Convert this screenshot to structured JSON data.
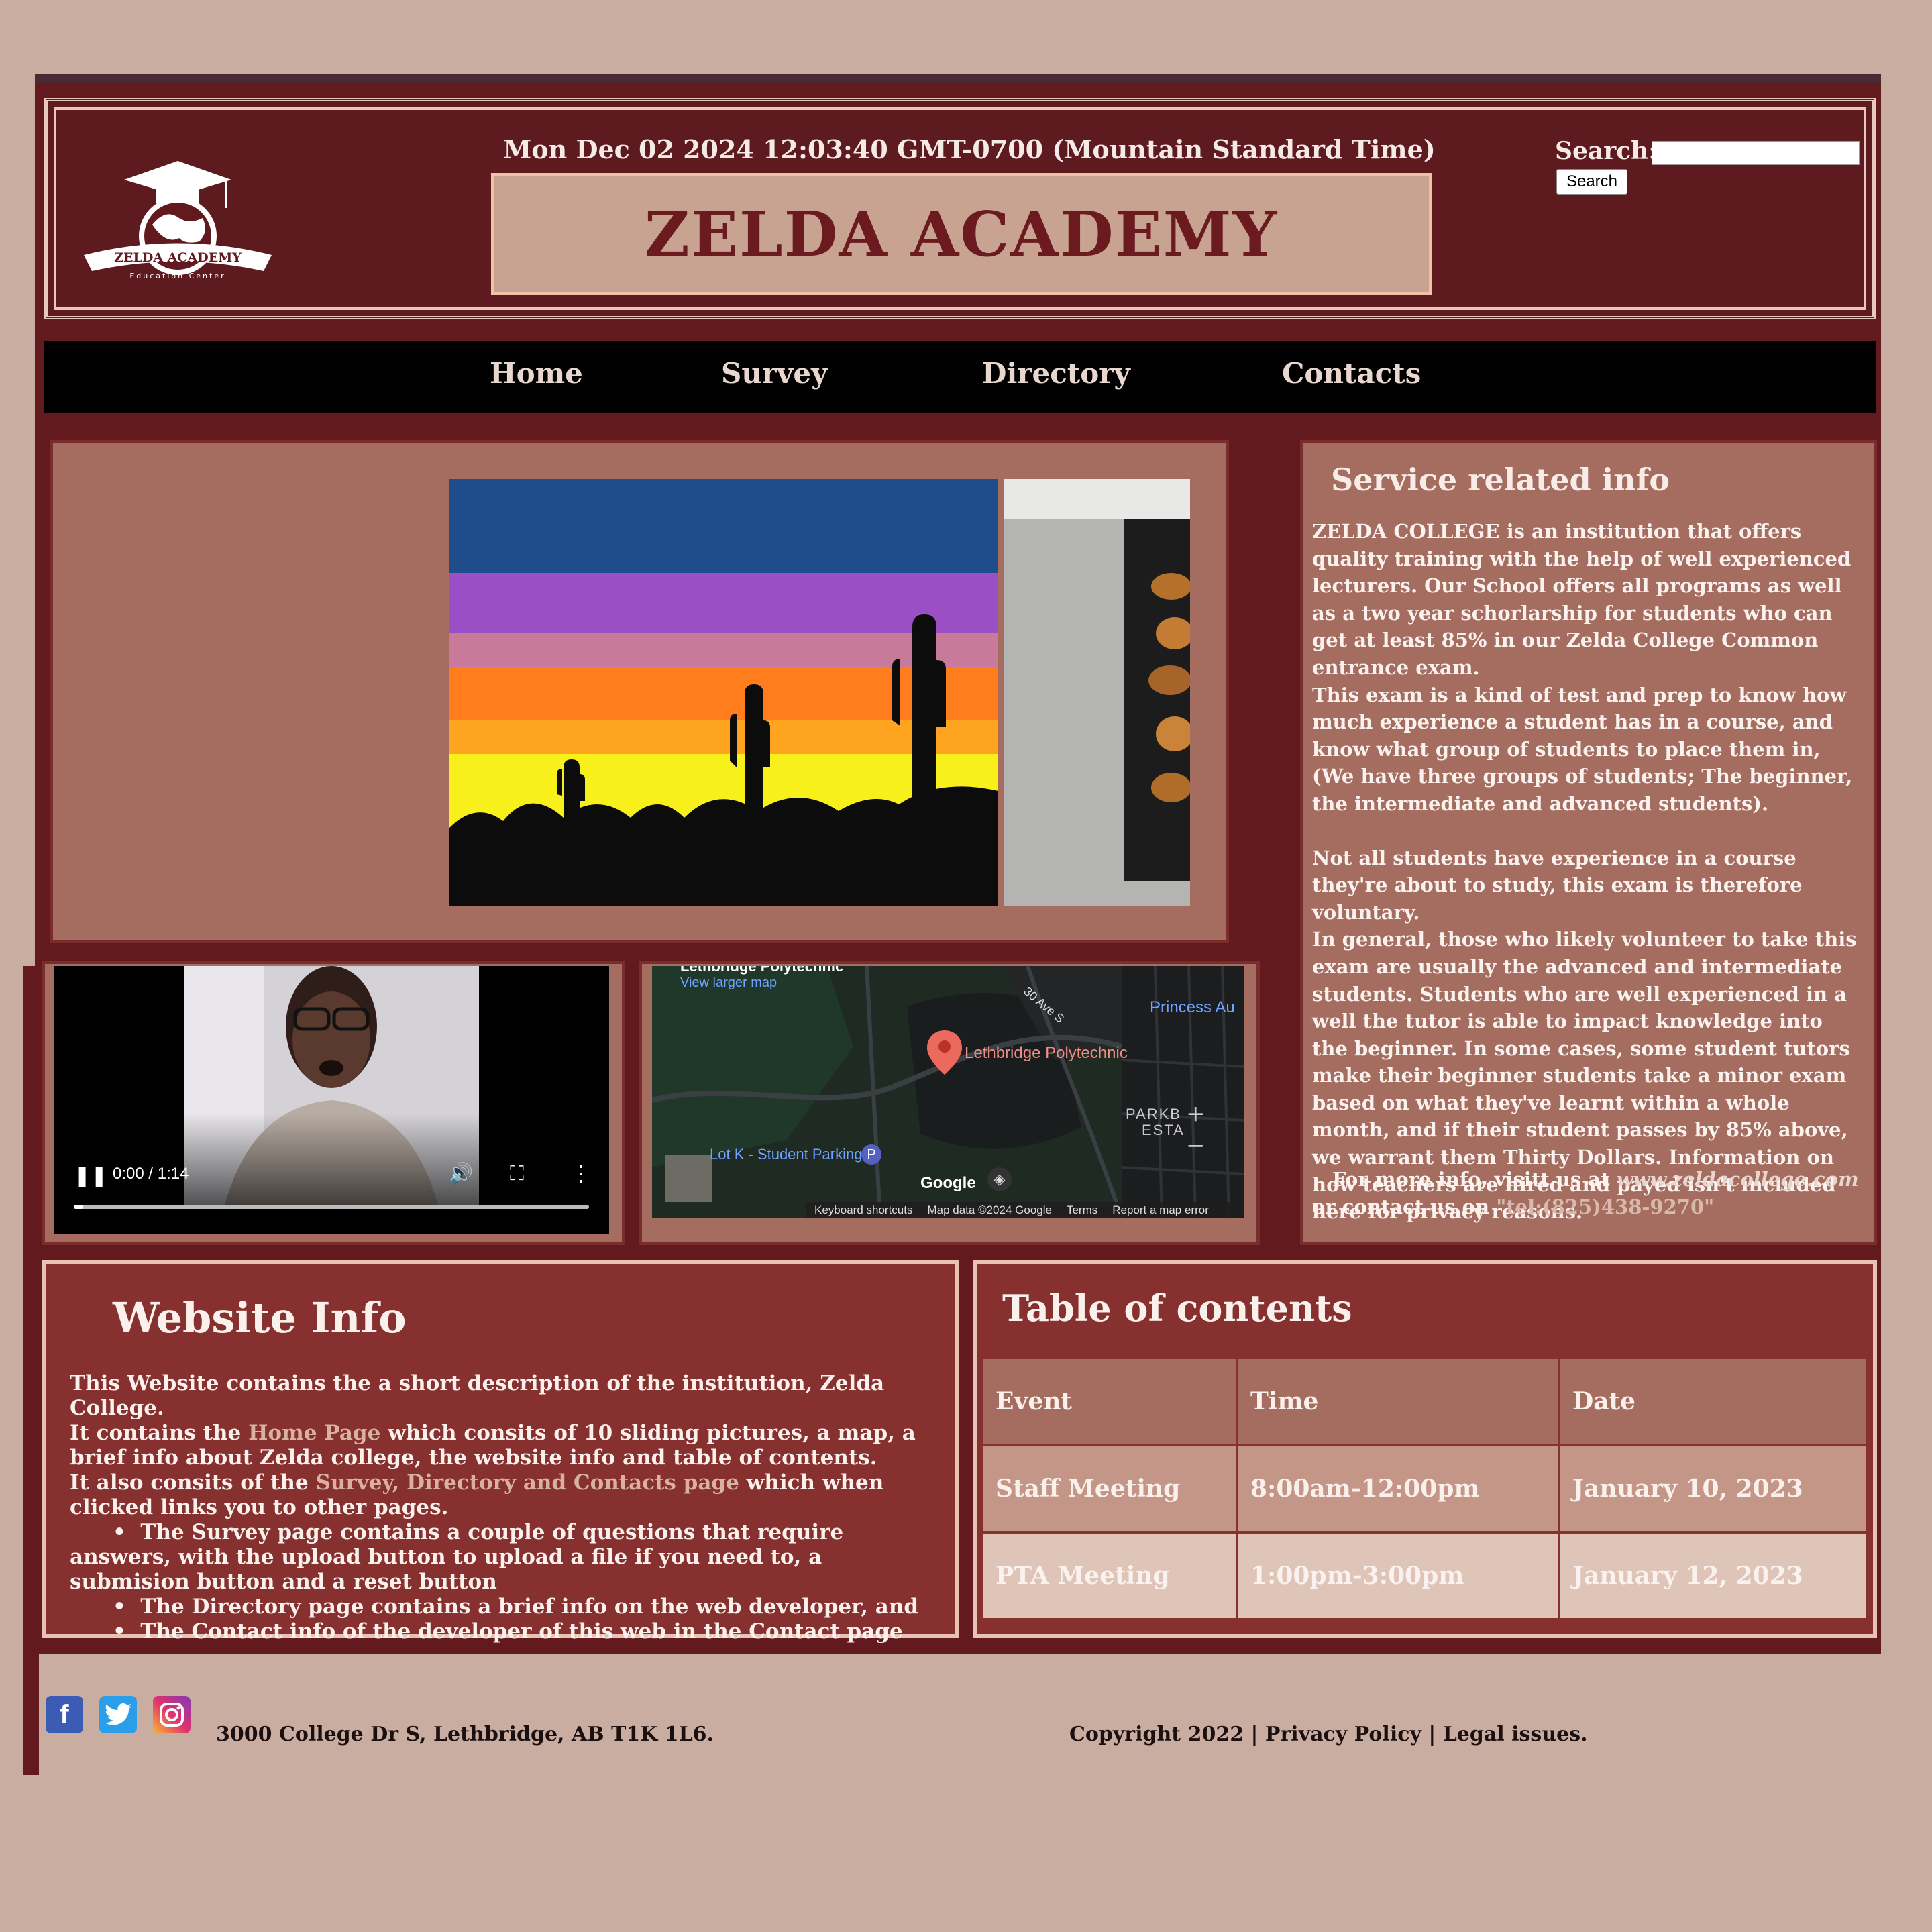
{
  "header": {
    "datetime": "Mon Dec 02 2024 12:03:40 GMT-0700 (Mountain Standard Time)",
    "title": "ZELDA ACADEMY",
    "logo_text": "ZELDA ACADEMY",
    "logo_subtext": "Education Center",
    "search_label": "Search:",
    "search_value": "",
    "search_button": "Search"
  },
  "nav": {
    "items": [
      "Home",
      "Survey",
      "Directory",
      "Contacts"
    ]
  },
  "service": {
    "title": "Service related info",
    "p1": "ZELDA COLLEGE is an institution that offers quality training with the help of well experienced lecturers. Our School offers all programs as well as a two year schorlarship for students who can get at least 85% in our Zelda College Common entrance exam.",
    "p2": "This exam is a kind of test and prep to know how much experience a student has in a course, and know what group of students to place them in, (We have three groups of students; The beginner, the intermediate and advanced students).",
    "p3": "Not all students have experience in a course they're about to study, this exam is therefore voluntary.",
    "p4": "In general, those who likely volunteer to take this exam are usually the advanced and intermediate students. Students who are well experienced in a well the tutor is able to impact knowledge into the beginner. In some cases, some student tutors make their beginner students take a minor exam based on what they've learnt within a whole month, and if their student passes by 85% above, we warrant them Thirty Dollars. Information on how teachers are hired and payed isn't included here for privacy reasons.",
    "more_prefix": "For more info, visitt us at",
    "more_link": "www.zeldacollege.com",
    "more_mid": "or contact us on",
    "more_tel": "\"tel:(825)438-9270\""
  },
  "video": {
    "time": "0:00 / 1:14",
    "progress": 0.0
  },
  "map": {
    "place_header": "Lethbridge Polytechnic",
    "view_larger": "View larger map",
    "marker_label": "Lethbridge Polytechnic",
    "road_label": "30 Ave S",
    "area_label": "Princess Au",
    "parking_label": "Lot K - Student Parking",
    "parkb_label": "PARKB",
    "esta_label": "ESTA",
    "logo": "Google",
    "footer_shortcuts": "Keyboard shortcuts",
    "footer_data": "Map data ©2024 Google",
    "footer_terms": "Terms",
    "footer_report": "Report a map error"
  },
  "website_info": {
    "title": "Website Info",
    "line1": "This Website contains the a short description of the institution, Zelda College.",
    "line2_pre": "It contains the",
    "line2_link": "Home Page",
    "line2_post": "which consits of 10 sliding pictures, a map, a brief info about Zelda college, the website info and table of contents.",
    "line3_pre": "It also consits of the",
    "line3_link": "Survey, Directory and Contacts page",
    "line3_post": "which when clicked links you to other pages.",
    "bullets": [
      "The Survey page contains a couple of questions that require answers, with the upload button to upload a file if you need to, a submision button and a reset button",
      "The Directory page contains a brief info on the web developer, and",
      "The Contact info of the developer of this web in the Contact page"
    ]
  },
  "toc": {
    "title": "Table of contents",
    "headers": [
      "Event",
      "Time",
      "Date"
    ],
    "rows": [
      [
        "Staff Meeting",
        "8:00am-12:00pm",
        "January 10, 2023"
      ],
      [
        "PTA Meeting",
        "1:00pm-3:00pm",
        "January 12, 2023"
      ]
    ]
  },
  "footer": {
    "address": "3000 College Dr S, Lethbridge, AB T1K 1L6.",
    "copyright": "Copyright 2022 | Privacy Policy | Legal issues.",
    "social": [
      "facebook-icon",
      "twitter-icon",
      "instagram-icon"
    ]
  },
  "colors": {
    "page_bg": "#c9ada0",
    "maroon": "#631a1f",
    "panel": "#a56d60",
    "accent_border": "#efc2a6"
  }
}
